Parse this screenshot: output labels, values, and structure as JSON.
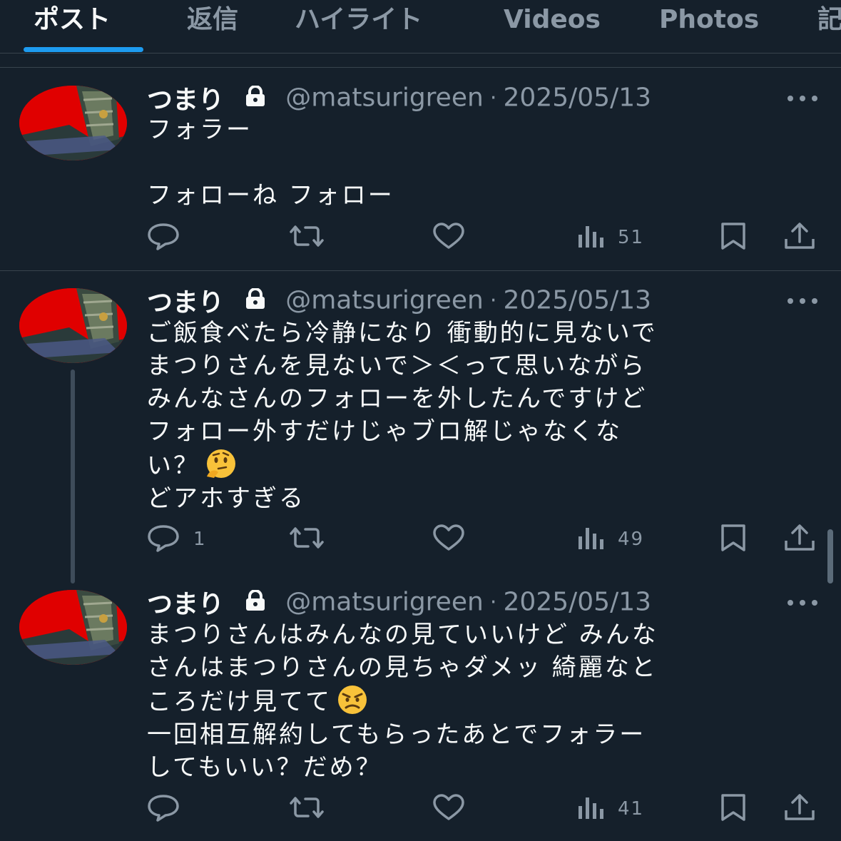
{
  "tabs": [
    {
      "label": "ポスト",
      "active": true
    },
    {
      "label": "返信"
    },
    {
      "label": "ハイライト"
    },
    {
      "label": "Videos"
    },
    {
      "label": "Photos"
    },
    {
      "label": "記"
    }
  ],
  "colors": {
    "background": "#15202b",
    "accent": "#1d9bf0",
    "text": "#f7f9f9",
    "muted": "#8b98a5",
    "divider": "#38444d"
  },
  "posts": [
    {
      "name": "つまり",
      "handle": "@matsurigreen",
      "separator": "·",
      "date": "2025/05/13",
      "text_lines": [
        "フォラー",
        "",
        "フォローね フォロー"
      ],
      "replies": "",
      "views": "51",
      "protected_icon": "lock-icon"
    },
    {
      "name": "つまり",
      "handle": "@matsurigreen",
      "separator": "·",
      "date": "2025/05/13",
      "text_lines": [
        "ご飯食べたら冷静になり 衝動的に見ないで",
        "まつりさんを見ないで＞＜って思いながら",
        "みんなさんのフォローを外したんですけど",
        "フォロー外すだけじゃブロ解じゃなくな",
        "い？",
        "どアホすぎる"
      ],
      "emoji_after_line": 4,
      "emoji": "thinking-face-emoji",
      "replies": "1",
      "views": "49",
      "protected_icon": "lock-icon"
    },
    {
      "name": "つまり",
      "handle": "@matsurigreen",
      "separator": "·",
      "date": "2025/05/13",
      "text_lines": [
        "まつりさんはみんなの見ていいけど みんな",
        "さんはまつりさんの見ちゃダメッ 綺麗なと",
        "ころだけ見てて",
        "一回相互解約してもらったあとでフォラー",
        "してもいい？だめ？"
      ],
      "emoji_after_line": 2,
      "emoji": "angry-face-emoji",
      "replies": "",
      "views": "41",
      "protected_icon": "lock-icon"
    }
  ]
}
